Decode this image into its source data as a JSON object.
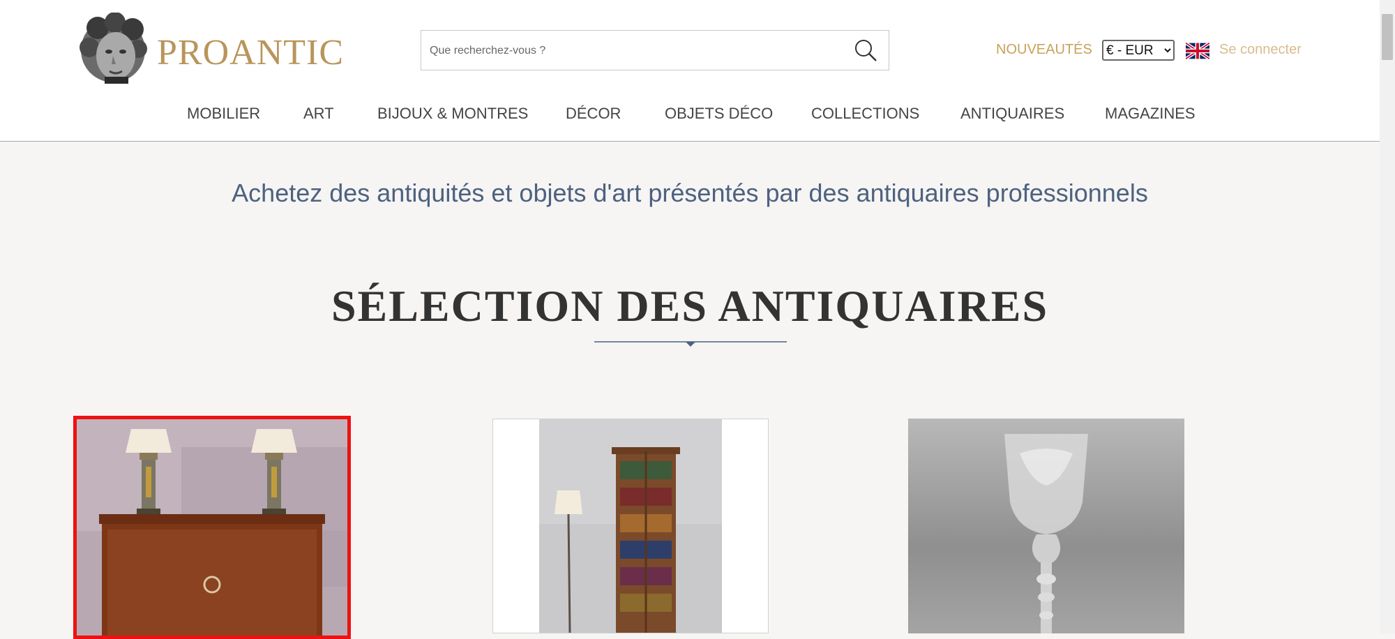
{
  "header": {
    "brand": "PROANTIC",
    "search": {
      "placeholder": "Que recherchez-vous ?"
    },
    "nouveautes_label": "NOUVEAUTÉS",
    "currency": {
      "selected": "€ - EUR",
      "options": [
        "€ - EUR"
      ]
    },
    "language_flag_icon": "uk-flag-icon",
    "login_label": "Se connecter"
  },
  "nav": {
    "items": [
      {
        "label": "MOBILIER"
      },
      {
        "label": "ART"
      },
      {
        "label": "BIJOUX & MONTRES"
      },
      {
        "label": "DÉCOR"
      },
      {
        "label": "OBJETS DÉCO"
      },
      {
        "label": "COLLECTIONS"
      },
      {
        "label": "ANTIQUAIRES"
      },
      {
        "label": "MAGAZINES"
      }
    ]
  },
  "main": {
    "tagline": "Achetez des antiquités et objets d'art présentés par des antiquaires professionnels",
    "section_title": "SÉLECTION DES ANTIQUAIRES",
    "products": [
      {
        "image": "commode-with-lamps-photo",
        "selected": true
      },
      {
        "image": "revolving-bookcase-photo",
        "selected": false
      },
      {
        "image": "engraved-glass-goblet-photo",
        "selected": false
      }
    ]
  },
  "colors": {
    "brand_gold": "#b8955a",
    "accent_gold": "#c9a15a",
    "nav_text": "#444444",
    "tagline_blue": "#4d6180",
    "selection_red": "#ee1111",
    "page_bg": "#f6f5f3"
  }
}
